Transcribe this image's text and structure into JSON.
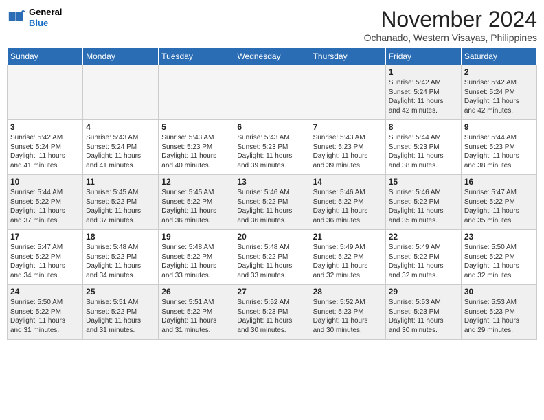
{
  "logo": {
    "line1": "General",
    "line2": "Blue"
  },
  "header": {
    "month_year": "November 2024",
    "location": "Ochanado, Western Visayas, Philippines"
  },
  "weekdays": [
    "Sunday",
    "Monday",
    "Tuesday",
    "Wednesday",
    "Thursday",
    "Friday",
    "Saturday"
  ],
  "weeks": [
    [
      {
        "day": "",
        "info": ""
      },
      {
        "day": "",
        "info": ""
      },
      {
        "day": "",
        "info": ""
      },
      {
        "day": "",
        "info": ""
      },
      {
        "day": "",
        "info": ""
      },
      {
        "day": "1",
        "info": "Sunrise: 5:42 AM\nSunset: 5:24 PM\nDaylight: 11 hours\nand 42 minutes."
      },
      {
        "day": "2",
        "info": "Sunrise: 5:42 AM\nSunset: 5:24 PM\nDaylight: 11 hours\nand 42 minutes."
      }
    ],
    [
      {
        "day": "3",
        "info": "Sunrise: 5:42 AM\nSunset: 5:24 PM\nDaylight: 11 hours\nand 41 minutes."
      },
      {
        "day": "4",
        "info": "Sunrise: 5:43 AM\nSunset: 5:24 PM\nDaylight: 11 hours\nand 41 minutes."
      },
      {
        "day": "5",
        "info": "Sunrise: 5:43 AM\nSunset: 5:23 PM\nDaylight: 11 hours\nand 40 minutes."
      },
      {
        "day": "6",
        "info": "Sunrise: 5:43 AM\nSunset: 5:23 PM\nDaylight: 11 hours\nand 39 minutes."
      },
      {
        "day": "7",
        "info": "Sunrise: 5:43 AM\nSunset: 5:23 PM\nDaylight: 11 hours\nand 39 minutes."
      },
      {
        "day": "8",
        "info": "Sunrise: 5:44 AM\nSunset: 5:23 PM\nDaylight: 11 hours\nand 38 minutes."
      },
      {
        "day": "9",
        "info": "Sunrise: 5:44 AM\nSunset: 5:23 PM\nDaylight: 11 hours\nand 38 minutes."
      }
    ],
    [
      {
        "day": "10",
        "info": "Sunrise: 5:44 AM\nSunset: 5:22 PM\nDaylight: 11 hours\nand 37 minutes."
      },
      {
        "day": "11",
        "info": "Sunrise: 5:45 AM\nSunset: 5:22 PM\nDaylight: 11 hours\nand 37 minutes."
      },
      {
        "day": "12",
        "info": "Sunrise: 5:45 AM\nSunset: 5:22 PM\nDaylight: 11 hours\nand 36 minutes."
      },
      {
        "day": "13",
        "info": "Sunrise: 5:46 AM\nSunset: 5:22 PM\nDaylight: 11 hours\nand 36 minutes."
      },
      {
        "day": "14",
        "info": "Sunrise: 5:46 AM\nSunset: 5:22 PM\nDaylight: 11 hours\nand 36 minutes."
      },
      {
        "day": "15",
        "info": "Sunrise: 5:46 AM\nSunset: 5:22 PM\nDaylight: 11 hours\nand 35 minutes."
      },
      {
        "day": "16",
        "info": "Sunrise: 5:47 AM\nSunset: 5:22 PM\nDaylight: 11 hours\nand 35 minutes."
      }
    ],
    [
      {
        "day": "17",
        "info": "Sunrise: 5:47 AM\nSunset: 5:22 PM\nDaylight: 11 hours\nand 34 minutes."
      },
      {
        "day": "18",
        "info": "Sunrise: 5:48 AM\nSunset: 5:22 PM\nDaylight: 11 hours\nand 34 minutes."
      },
      {
        "day": "19",
        "info": "Sunrise: 5:48 AM\nSunset: 5:22 PM\nDaylight: 11 hours\nand 33 minutes."
      },
      {
        "day": "20",
        "info": "Sunrise: 5:48 AM\nSunset: 5:22 PM\nDaylight: 11 hours\nand 33 minutes."
      },
      {
        "day": "21",
        "info": "Sunrise: 5:49 AM\nSunset: 5:22 PM\nDaylight: 11 hours\nand 32 minutes."
      },
      {
        "day": "22",
        "info": "Sunrise: 5:49 AM\nSunset: 5:22 PM\nDaylight: 11 hours\nand 32 minutes."
      },
      {
        "day": "23",
        "info": "Sunrise: 5:50 AM\nSunset: 5:22 PM\nDaylight: 11 hours\nand 32 minutes."
      }
    ],
    [
      {
        "day": "24",
        "info": "Sunrise: 5:50 AM\nSunset: 5:22 PM\nDaylight: 11 hours\nand 31 minutes."
      },
      {
        "day": "25",
        "info": "Sunrise: 5:51 AM\nSunset: 5:22 PM\nDaylight: 11 hours\nand 31 minutes."
      },
      {
        "day": "26",
        "info": "Sunrise: 5:51 AM\nSunset: 5:22 PM\nDaylight: 11 hours\nand 31 minutes."
      },
      {
        "day": "27",
        "info": "Sunrise: 5:52 AM\nSunset: 5:23 PM\nDaylight: 11 hours\nand 30 minutes."
      },
      {
        "day": "28",
        "info": "Sunrise: 5:52 AM\nSunset: 5:23 PM\nDaylight: 11 hours\nand 30 minutes."
      },
      {
        "day": "29",
        "info": "Sunrise: 5:53 AM\nSunset: 5:23 PM\nDaylight: 11 hours\nand 30 minutes."
      },
      {
        "day": "30",
        "info": "Sunrise: 5:53 AM\nSunset: 5:23 PM\nDaylight: 11 hours\nand 29 minutes."
      }
    ]
  ]
}
